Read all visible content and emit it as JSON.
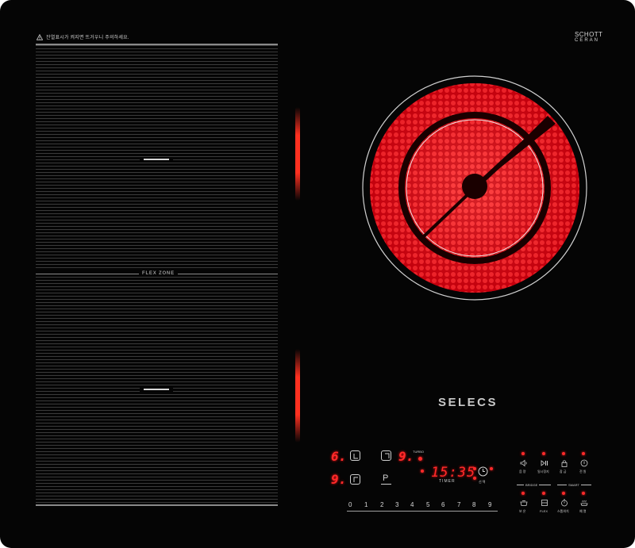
{
  "warning_text": "잔열표시가 켜지면 뜨거우니 주의하세요.",
  "brand": {
    "schott": "SCHOTT",
    "ceran": "CERAN",
    "logo": "SELECS"
  },
  "flex_zone_label": "FLEX ZONE",
  "colors": {
    "glass": "#050505",
    "heat": "#ff2a2a",
    "print": "#cfcfcf"
  },
  "left_zone": {
    "front_level": "6.",
    "rear_level": "9."
  },
  "right_zone": {
    "level": "9.",
    "turbo_label": "TURBO"
  },
  "timer": {
    "display": "15:35",
    "label": "TIMER",
    "select_label": "선 택"
  },
  "pause_key": "P",
  "slider": {
    "levels": [
      "0",
      "1",
      "2",
      "3",
      "4",
      "5",
      "6",
      "7",
      "8",
      "9"
    ]
  },
  "functions_top": [
    {
      "icon": "speaker-icon",
      "label": "음 량"
    },
    {
      "icon": "play-pause-icon",
      "label": "일시정지"
    },
    {
      "icon": "lock-icon",
      "label": "잠 금"
    },
    {
      "icon": "power-icon",
      "label": "전 원"
    }
  ],
  "section_labels": {
    "left": "BRIDGE",
    "right": "SMART"
  },
  "functions_bottom": [
    {
      "icon": "pot-icon",
      "label": "보 온"
    },
    {
      "icon": "flex-grid-icon",
      "label": "FLEX"
    },
    {
      "icon": "auto-timer-icon",
      "label": "스톱워치"
    },
    {
      "icon": "keep-warm-icon",
      "label": "예 열"
    }
  ]
}
